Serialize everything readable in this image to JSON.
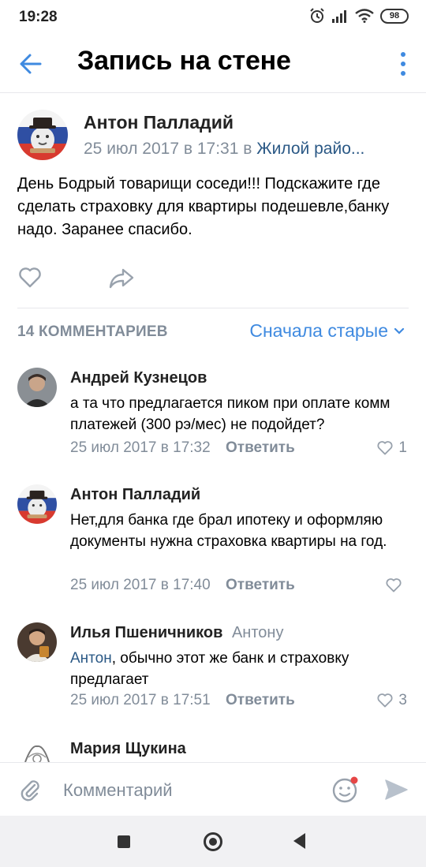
{
  "status_bar": {
    "time": "19:28",
    "battery": "98"
  },
  "header": {
    "title": "Запись на стене"
  },
  "post": {
    "author": "Антон Палладий",
    "date": "25 июл 2017 в 17:31",
    "in_word": "в",
    "group": "Жилой райо...",
    "text": "День Бодрый товарищи соседи!!! Подскажите где сделать страховку для квартиры подешевле,банку надо. Заранее спасибо."
  },
  "comments_header": {
    "count_label": "14 КОММЕНТАРИЕВ",
    "sort_label": "Сначала старые"
  },
  "comments": [
    {
      "author": "Андрей Кузнецов",
      "reply_to": "",
      "mention": "",
      "text": "а та что предлагается пиком при оплате комм платежей (300 рэ/мес) не подойдет?",
      "date": "25 июл 2017 в 17:32",
      "reply_label": "Ответить",
      "likes": "1"
    },
    {
      "author": "Антон Палладий",
      "reply_to": "",
      "mention": "",
      "text": "Нет,для банка где брал ипотеку и оформляю документы нужна страховка квартиры на год.",
      "date": "25 июл 2017 в 17:40",
      "reply_label": "Ответить",
      "likes": ""
    },
    {
      "author": "Илья Пшеничников",
      "reply_to": "Антону",
      "mention": "Антон",
      "text": ", обычно этот же банк и страховку предлагает",
      "date": "25 июл 2017 в 17:51",
      "reply_label": "Ответить",
      "likes": "3"
    },
    {
      "author": "Мария Щукина"
    }
  ],
  "composer": {
    "placeholder": "Комментарий"
  },
  "colors": {
    "accent": "#3f8ae0",
    "link": "#2a5885",
    "secondary_text": "#818c99",
    "notification_dot": "#e64646"
  }
}
